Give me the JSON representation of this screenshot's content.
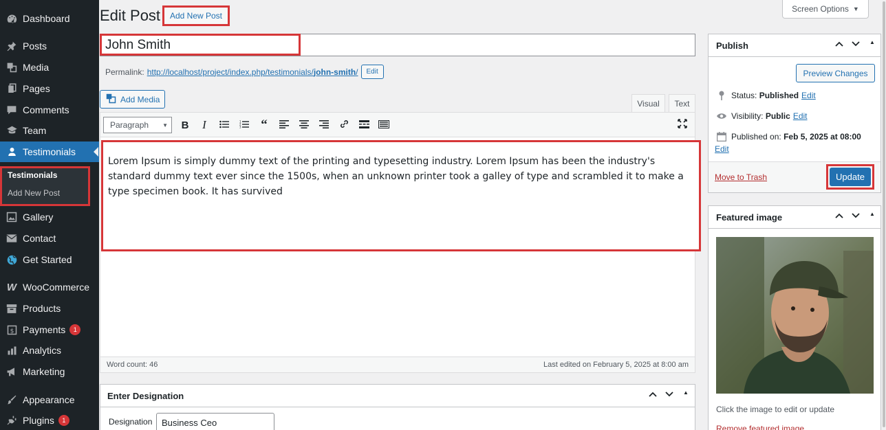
{
  "sidebar": {
    "items": [
      {
        "label": "Dashboard",
        "icon": "dashboard-icon"
      },
      {
        "label": "Posts",
        "icon": "pin-icon"
      },
      {
        "label": "Media",
        "icon": "media-icon"
      },
      {
        "label": "Pages",
        "icon": "pages-icon"
      },
      {
        "label": "Comments",
        "icon": "comments-icon"
      },
      {
        "label": "Team",
        "icon": "team-icon"
      },
      {
        "label": "Testimonials",
        "icon": "user-icon"
      },
      {
        "label": "Gallery",
        "icon": "gallery-icon"
      },
      {
        "label": "Contact",
        "icon": "envelope-icon"
      },
      {
        "label": "Get Started",
        "icon": "globe-icon"
      },
      {
        "label": "WooCommerce",
        "icon": "woo-icon"
      },
      {
        "label": "Products",
        "icon": "archive-icon"
      },
      {
        "label": "Payments",
        "icon": "dollar-icon",
        "badge": "1"
      },
      {
        "label": "Analytics",
        "icon": "bar-chart-icon"
      },
      {
        "label": "Marketing",
        "icon": "megaphone-icon"
      },
      {
        "label": "Appearance",
        "icon": "brush-icon"
      },
      {
        "label": "Plugins",
        "icon": "plug-icon",
        "badge": "1"
      }
    ],
    "submenu": {
      "current": "Testimonials",
      "add_new": "Add New Post"
    }
  },
  "header": {
    "title": "Edit Post",
    "add_new": "Add New Post",
    "screen_options": "Screen Options"
  },
  "post": {
    "title": "John Smith",
    "permalink_label": "Permalink:",
    "permalink_base": "http://localhost/project/index.php/testimonials/",
    "permalink_slug": "john-smith",
    "permalink_end": "/",
    "permalink_edit": "Edit"
  },
  "editor": {
    "add_media": "Add Media",
    "tabs": {
      "visual": "Visual",
      "text": "Text"
    },
    "format": "Paragraph",
    "content": "Lorem Ipsum is simply dummy text of the printing and typesetting industry. Lorem Ipsum has been the industry's standard dummy text ever since the 1500s, when an unknown printer took a galley of type and scrambled it to make a type specimen book. It has survived",
    "word_count": "Word count: 46",
    "last_edited": "Last edited on February 5, 2025 at 8:00 am"
  },
  "designation": {
    "title": "Enter Designation",
    "label": "Designation",
    "value": "Business Ceo"
  },
  "publish": {
    "title": "Publish",
    "preview": "Preview Changes",
    "status_label": "Status:",
    "status_value": "Published",
    "visibility_label": "Visibility:",
    "visibility_value": "Public",
    "published_label": "Published on:",
    "published_value": "Feb 5, 2025 at 08:00",
    "edit": "Edit",
    "trash": "Move to Trash",
    "update": "Update"
  },
  "featured": {
    "title": "Featured image",
    "hint": "Click the image to edit or update",
    "remove": "Remove featured image"
  },
  "colors": {
    "accent": "#2271b1",
    "sidebar": "#1d2327",
    "highlight": "#d63638"
  }
}
